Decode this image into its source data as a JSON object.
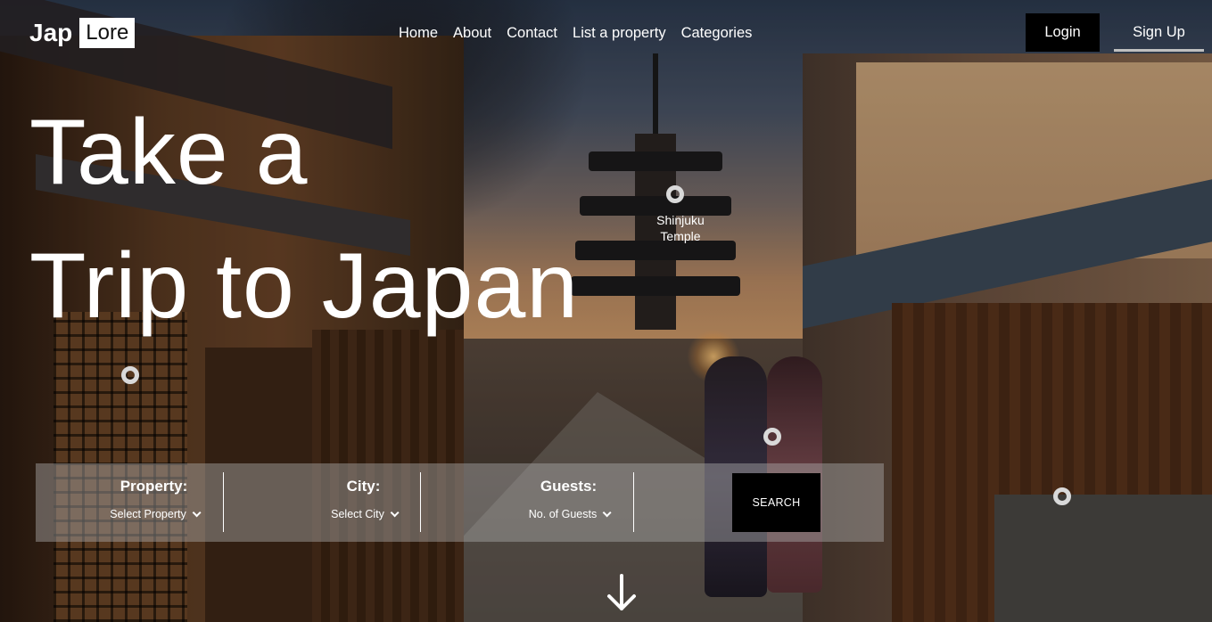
{
  "logo": {
    "part1": "Jap",
    "part2": "Lore"
  },
  "nav": {
    "items": [
      "Home",
      "About",
      "Contact",
      "List a property",
      "Categories"
    ],
    "login": "Login",
    "signup": "Sign Up"
  },
  "hero": {
    "line1": "Take a",
    "line2": "Trip to Japan"
  },
  "hotspots": {
    "temple_label_1": "Shinjuku",
    "temple_label_2": "Temple"
  },
  "search": {
    "property_label": "Property:",
    "property_value": "Select Property",
    "city_label": "City:",
    "city_value": "Select City",
    "guests_label": "Guests:",
    "guests_value": "No. of Guests",
    "button": "SEARCH"
  },
  "colors": {
    "accent": "#000000",
    "signup_underline": "#bfbfbf",
    "searchbar_bg": "rgba(170,170,170,0.45)"
  },
  "icons": {
    "scroll_down": "arrow-down-icon",
    "select_chevron": "chevron-down-icon"
  }
}
